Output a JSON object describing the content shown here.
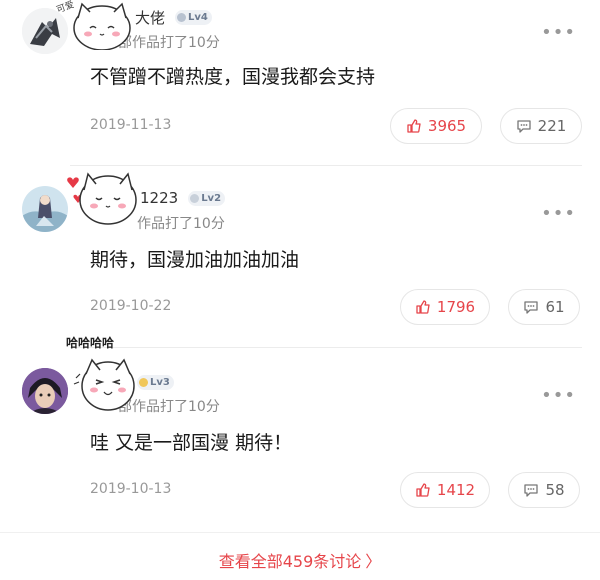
{
  "comments": [
    {
      "username": "大佬",
      "level": "Lv4",
      "rating_text": "部作品打了10分",
      "body": "不管蹭不蹭热度，国漫我都会支持",
      "date": "2019-11-13",
      "likes": "3965",
      "replies": "221",
      "sticker_text": "可爱"
    },
    {
      "username": "1223",
      "level": "Lv2",
      "rating_text": "作品打了10分",
      "body": "期待，国漫加油加油加油",
      "date": "2019-10-22",
      "likes": "1796",
      "replies": "61"
    },
    {
      "username": "",
      "level": "Lv3",
      "rating_text": "部作品打了10分",
      "body": "哇 又是一部国漫 期待！",
      "date": "2019-10-13",
      "likes": "1412",
      "replies": "58",
      "sticker_text": "哈哈哈哈"
    }
  ],
  "footer": {
    "view_all": "查看全部459条讨论"
  },
  "icons": {
    "like": "thumbs-up-icon",
    "reply": "comment-bubble-icon",
    "more": "more-dots-icon"
  },
  "colors": {
    "accent": "#e6454a",
    "badge_bg": "#eef1f5",
    "muted": "#999999"
  }
}
